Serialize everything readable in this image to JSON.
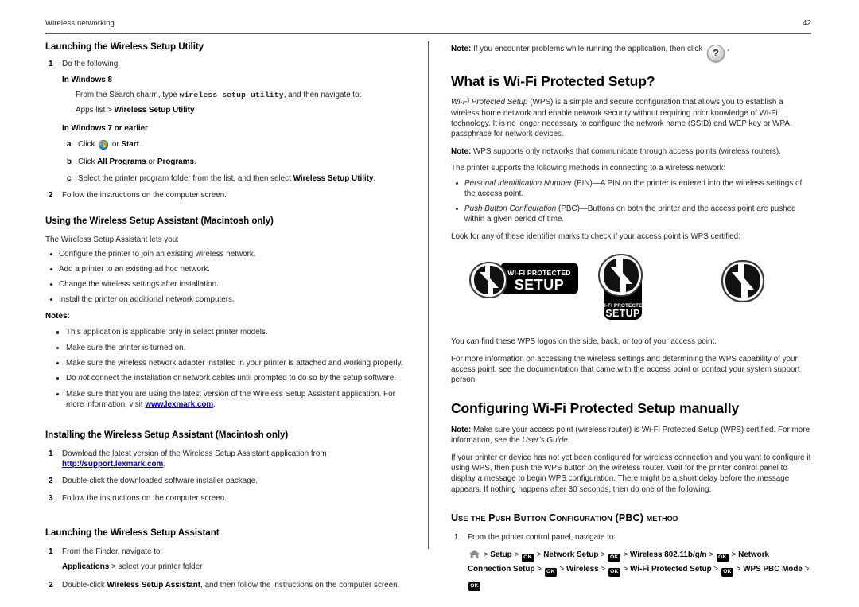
{
  "header": {
    "title": "Wireless networking",
    "page_number": "42"
  },
  "left_column": {
    "section1": {
      "heading": "Launching the Wireless Setup Utility",
      "step1_label": "1",
      "step1_text": "Do the following:",
      "win8_heading": "In Windows 8",
      "win8_line1_pre": "From the Search charm, type ",
      "win8_line1_mono": "wireless setup utility",
      "win8_line1_post": ", and then navigate to:",
      "win8_line2_pre": "Apps list > ",
      "win8_line2_bold": "Wireless Setup Utility",
      "win7_heading": "In Windows 7 or earlier",
      "sub_a_label": "a",
      "sub_a_pre": "Click ",
      "sub_a_icon": "windows-orb-icon",
      "sub_a_mid": " or ",
      "sub_a_bold": "Start",
      "sub_a_post": ".",
      "sub_b_label": "b",
      "sub_b_pre": "Click ",
      "sub_b_bold1": "All Programs",
      "sub_b_mid": " or ",
      "sub_b_bold2": "Programs",
      "sub_b_post": ".",
      "sub_c_label": "c",
      "sub_c_pre": "Select the printer program folder from the list, and then select ",
      "sub_c_bold": "Wireless Setup Utility",
      "sub_c_post": ".",
      "step2_label": "2",
      "step2_text": "Follow the instructions on the computer screen."
    },
    "section2": {
      "heading": "Using the Wireless Setup Assistant (Macintosh only)",
      "intro": "The Wireless Setup Assistant lets you:",
      "bullets": [
        "Configure the printer to join an existing wireless network.",
        "Add a printer to an existing ad hoc network.",
        "Change the wireless settings after installation.",
        "Install the printer on additional network computers."
      ],
      "notes_label": "Notes:",
      "notes": [
        {
          "text": "This application is applicable only in select printer models."
        },
        {
          "text": "Make sure the printer is turned on."
        },
        {
          "text": "Make sure the wireless network adapter installed in your printer is attached and working properly."
        },
        {
          "pre": "Do ",
          "italic": "not",
          "post": " connect the installation or network cables until prompted to do so by the setup software."
        },
        {
          "pre": "Make sure that you are using the latest version of the Wireless Setup Assistant application. For more information, visit ",
          "link": "www.lexmark.com",
          "post": "."
        }
      ]
    },
    "section3": {
      "heading": "Installing the Wireless Setup Assistant (Macintosh only)",
      "steps": [
        {
          "num": "1",
          "pre": "Download the latest version of the Wireless Setup Assistant application from ",
          "link": "http://support.lexmark.com",
          "post": "."
        },
        {
          "num": "2",
          "pre": "Double-click the downloaded software installer package."
        },
        {
          "num": "3",
          "pre": "Follow the instructions on the computer screen."
        }
      ]
    },
    "section4": {
      "heading": "Launching the Wireless Setup Assistant",
      "step1_label": "1",
      "step1_text": "From the Finder, navigate to:",
      "step1_path_bold": "Applications",
      "step1_path_rest": " > select your printer folder",
      "step2_label": "2",
      "step2_pre": "Double-click ",
      "step2_bold": "Wireless Setup Assistant",
      "step2_post": ", and then follow the instructions on the computer screen."
    }
  },
  "right_column": {
    "note_top": {
      "label": "Note:",
      "text_pre": " If you encounter problems while running the application, then click ",
      "icon": "help-question-icon",
      "text_post": "."
    },
    "section_wps": {
      "heading": "What is Wi-Fi Protected Setup?",
      "para1_italic": "Wi‑Fi Protected Setup",
      "para1_rest": " (WPS) is a simple and secure configuration that allows you to establish a wireless home network and enable network security without requiring prior knowledge of Wi-Fi technology. It is no longer necessary to configure the network name (SSID) and WEP key or WPA passphrase for network devices.",
      "note_label": "Note:",
      "note_text": "  WPS supports only networks that communicate through access points (wireless routers).",
      "methods_intro": "The printer supports the following methods in connecting to a wireless network:",
      "methods": [
        {
          "italic": "Personal Identification Number",
          "rest": " (PIN)—A PIN on the printer is entered into the wireless settings of the access point."
        },
        {
          "italic": "Push Button Configuration",
          "rest": " (PBC)—Buttons on both the printer and the access point are pushed within a given period of time."
        }
      ],
      "identifier_intro": "Look for any of these identifier marks to check if your access point is WPS certified:",
      "logos": [
        {
          "name": "wps-logo-horizontal",
          "line1": "WI-FI PROTECTED",
          "line2": "SETUP"
        },
        {
          "name": "wps-logo-vertical",
          "line1": "WI-FI PROTECTED",
          "line2": "SETUP"
        },
        {
          "name": "wps-logo-mark-only",
          "line1": "",
          "line2": ""
        }
      ],
      "after_logos_1": "You can find these WPS logos on the side, back, or top of your access point.",
      "after_logos_2": "For more information on accessing the wireless settings and determining the WPS capability of your access point, see the documentation that came with the access point or contact your system support person."
    },
    "section_manual": {
      "heading": "Configuring Wi-Fi Protected Setup manually",
      "note_label": "Note:",
      "note_pre": " Make sure your access point (wireless router) is Wi-Fi Protected Setup (WPS) certified. For more information, see the ",
      "note_italic": "User’s Guide",
      "note_post": ".",
      "para": "If your printer or device has not yet been configured for wireless connection and you want to configure it using WPS, then push the WPS button on the wireless router. Wait for the printer control panel to display a message to begin WPS configuration. There might be a short delay before the message appears. If nothing happens after 30 seconds, then do one of the following:",
      "pbc_heading": "Use the Push Button Configuration (PBC) method",
      "step1_label": "1",
      "step1_text": "From the printer control panel, navigate to:",
      "nav_path": [
        {
          "type": "icon",
          "name": "home-icon"
        },
        {
          "type": "sep",
          "text": ">"
        },
        {
          "type": "bold",
          "text": "Setup"
        },
        {
          "type": "sep",
          "text": ">"
        },
        {
          "type": "key",
          "text": "OK"
        },
        {
          "type": "sep",
          "text": ">"
        },
        {
          "type": "bold",
          "text": "Network Setup"
        },
        {
          "type": "sep",
          "text": ">"
        },
        {
          "type": "key",
          "text": "OK"
        },
        {
          "type": "sep",
          "text": ">"
        },
        {
          "type": "bold",
          "text": "Wireless 802.11b/g/n"
        },
        {
          "type": "sep",
          "text": ">"
        },
        {
          "type": "key",
          "text": "OK"
        },
        {
          "type": "sep",
          "text": ">"
        },
        {
          "type": "bold",
          "text": "Network Connection Setup"
        },
        {
          "type": "sep",
          "text": ">"
        },
        {
          "type": "key",
          "text": "OK"
        },
        {
          "type": "sep",
          "text": ">"
        },
        {
          "type": "bold",
          "text": "Wireless"
        },
        {
          "type": "sep",
          "text": ">"
        },
        {
          "type": "key",
          "text": "OK"
        },
        {
          "type": "sep",
          "text": ">"
        },
        {
          "type": "bold",
          "text": "Wi-Fi Protected Setup"
        },
        {
          "type": "sep",
          "text": ">"
        },
        {
          "type": "key",
          "text": "OK"
        },
        {
          "type": "sep",
          "text": ">"
        },
        {
          "type": "bold",
          "text": "WPS PBC Mode"
        },
        {
          "type": "sep",
          "text": ">"
        },
        {
          "type": "key",
          "text": "OK"
        }
      ]
    }
  },
  "colors": {
    "rule": "#58595b",
    "link": "#0000cc",
    "text": "#231f20"
  }
}
